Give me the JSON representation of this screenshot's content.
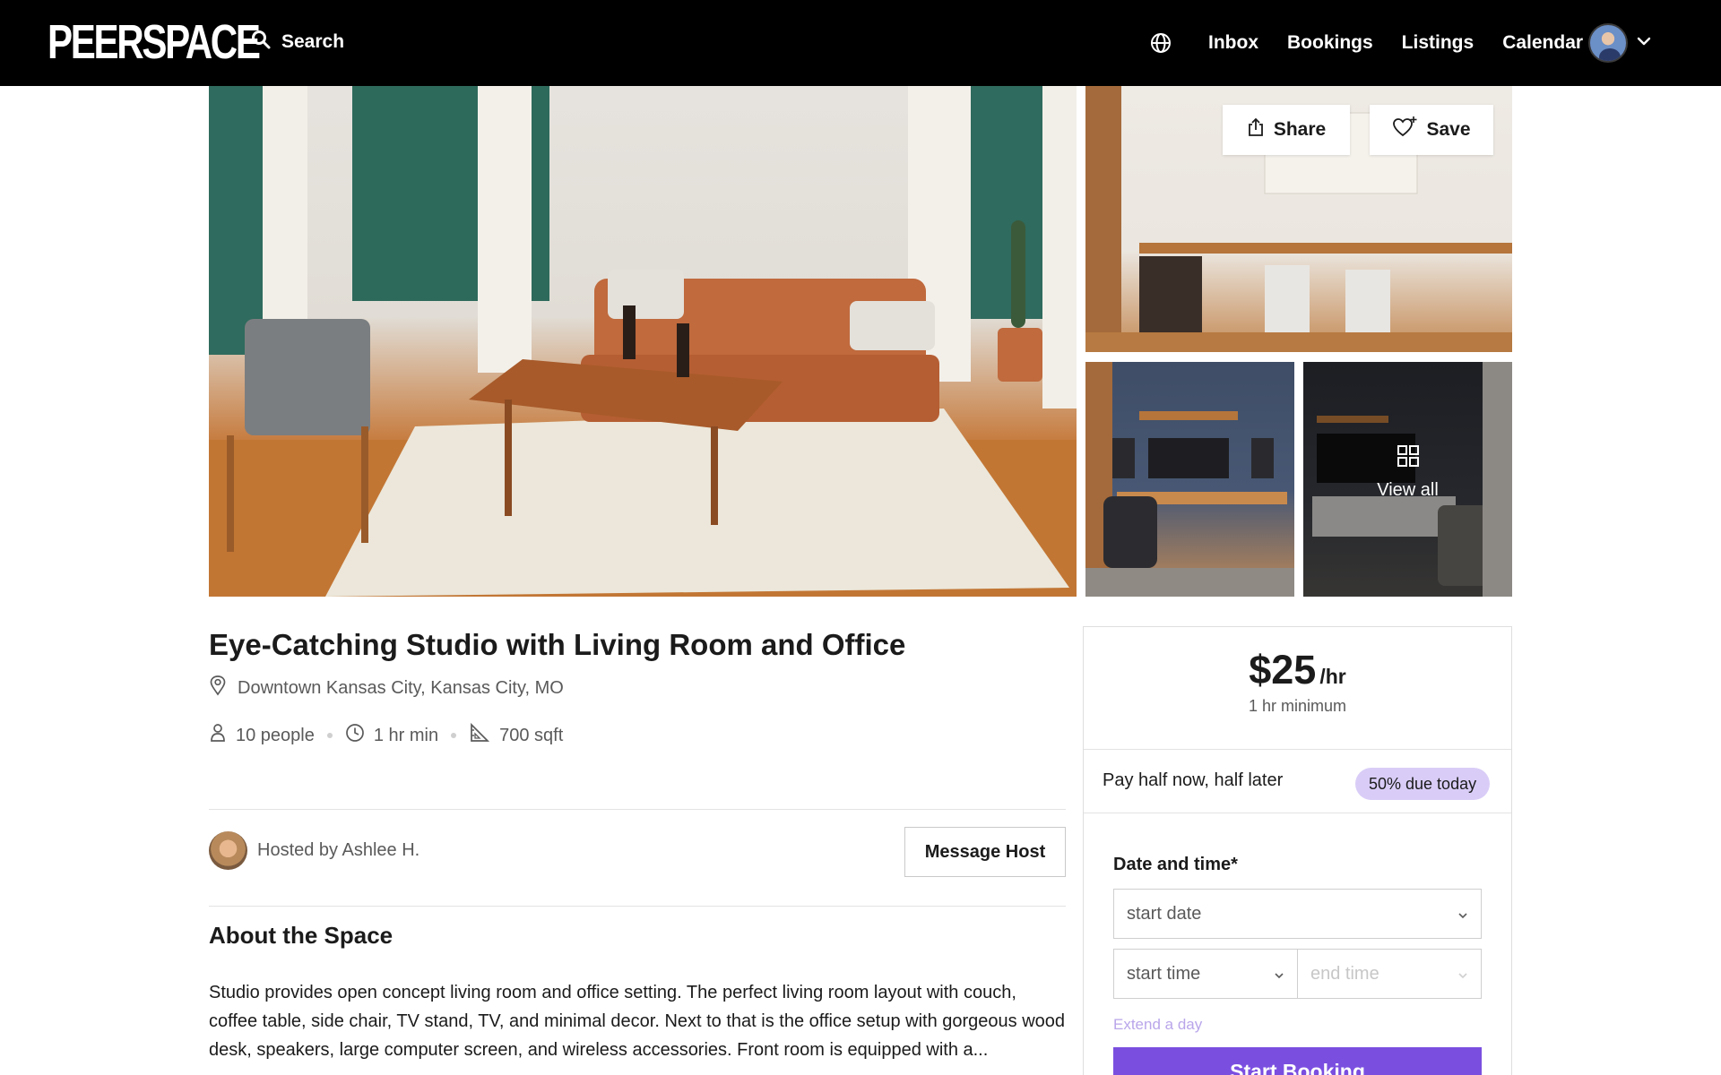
{
  "nav": {
    "logo": "PEERSPACE",
    "search_label": "Search",
    "links": [
      "Inbox",
      "Bookings",
      "Listings",
      "Calendar"
    ]
  },
  "gallery": {
    "share_label": "Share",
    "save_label": "Save",
    "view_all_label": "View all"
  },
  "listing": {
    "title": "Eye-Catching Studio with Living Room and Office",
    "location": "Downtown Kansas City, Kansas City, MO",
    "capacity": "10 people",
    "min_time": "1 hr min",
    "size": "700 sqft",
    "host": "Hosted by Ashlee H.",
    "message_host_label": "Message Host",
    "about_title": "About the Space",
    "about_text": "Studio provides open concept living room and office setting. The perfect living room layout with couch, coffee table, side chair, TV stand, TV, and minimal decor. Next to that is the office setup with gorgeous wood desk, speakers, large computer screen, and wireless accessories. Front room is equipped with a..."
  },
  "booking": {
    "price": "$25",
    "price_unit": "/hr",
    "minimum": "1 hr minimum",
    "pay_text": "Pay half now, half later",
    "pay_badge": "50% due today",
    "date_label": "Date and time*",
    "start_date_placeholder": "start date",
    "start_time_placeholder": "start time",
    "end_time_placeholder": "end time",
    "extend_label": "Extend a day",
    "start_booking_label": "Start Booking"
  },
  "colors": {
    "nav_bg": "#000000",
    "accent": "#7a4fe0",
    "badge_bg": "#d9cdf7"
  }
}
